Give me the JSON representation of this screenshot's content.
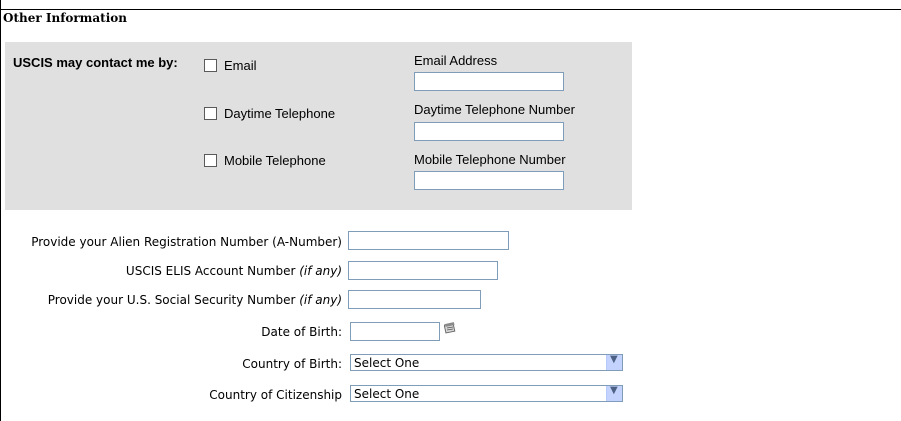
{
  "section": {
    "title": "Other Information"
  },
  "contact": {
    "label": "USCIS may contact me by:",
    "options": [
      {
        "check_label": "Email",
        "field_label": "Email Address",
        "value": ""
      },
      {
        "check_label": "Daytime Telephone",
        "field_label": "Daytime Telephone Number",
        "value": ""
      },
      {
        "check_label": "Mobile Telephone",
        "field_label": "Mobile Telephone Number",
        "value": ""
      }
    ]
  },
  "fields": {
    "a_number": {
      "label": "Provide your Alien Registration Number (A-Number)",
      "value": ""
    },
    "elis": {
      "label": "USCIS ELIS Account Number ",
      "hint": "(if any)",
      "value": ""
    },
    "ssn": {
      "label": "Provide your U.S. Social Security Number ",
      "hint": "(if any)",
      "value": ""
    },
    "dob": {
      "label": "Date of Birth:",
      "value": ""
    },
    "country_birth": {
      "label": "Country of Birth:",
      "value": "Select One"
    },
    "country_citizenship": {
      "label": "Country of Citizenship",
      "value": "Select One"
    }
  },
  "icons": {
    "calendar": "calendar-icon",
    "dropdown": "chevron-down-icon"
  },
  "colors": {
    "panel": "#e0e0e0",
    "input_border": "#7f9db9",
    "select_arrow_bg": "#c3d3fd"
  }
}
